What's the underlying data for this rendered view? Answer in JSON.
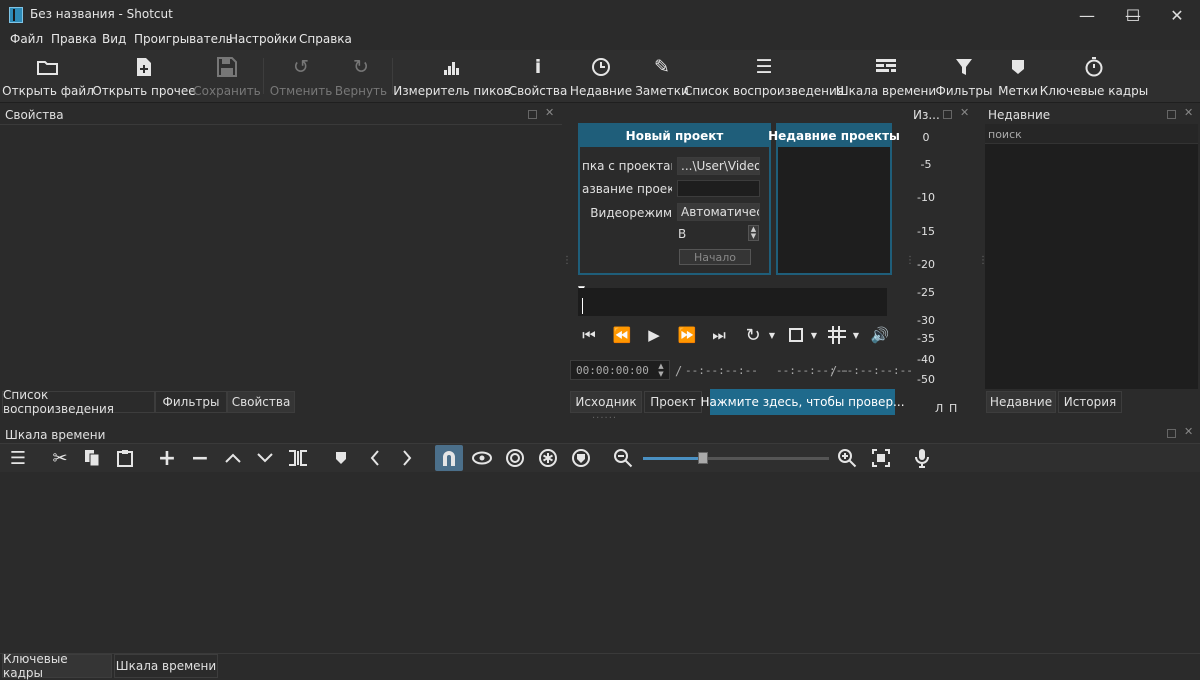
{
  "window": {
    "title": "Без названия - Shotcut",
    "minimize": "—",
    "maximize": "☐",
    "close": "✕"
  },
  "menu": [
    "Файл",
    "Правка",
    "Вид",
    "Проигрыватель",
    "Настройки",
    "Справка"
  ],
  "toolbar": {
    "open_file": "Открыть файл",
    "open_other": "Открыть прочее",
    "save": "Сохранить",
    "undo": "Отменить",
    "redo": "Вернуть",
    "peak_meter": "Измеритель пиков",
    "properties": "Свойства",
    "recent": "Недавние",
    "notes": "Заметки",
    "playlist": "Список воспроизведения",
    "timeline": "Шкала времени",
    "filters": "Фильтры",
    "markers": "Метки",
    "keyframes": "Ключевые кадры"
  },
  "properties_panel": {
    "title": "Свойства",
    "tabs": [
      "Список воспроизведения",
      "Фильтры",
      "Свойства"
    ]
  },
  "start_page": {
    "new_project_title": "Новый проект",
    "recent_projects_title": "Недавние проекты",
    "projects_folder_label": "пка с проектами",
    "projects_folder_value": "...\\User\\Videos",
    "project_name_label": "азвание проекта",
    "project_name_value": "",
    "video_mode_label": "Видеорежим",
    "video_mode_value": "Автоматически",
    "spin_value": "В",
    "start_button": "Начало"
  },
  "player": {
    "timecode": "00:00:00:00",
    "separator": "/",
    "duration": "--:--:--:--",
    "in_point": "--:--:--:--",
    "out_separator": "/",
    "out_point": "--:--:--:--",
    "tabs": [
      "Исходник",
      "Проект"
    ],
    "update_notice": "Нажмите здесь, чтобы провер..."
  },
  "meter": {
    "title": "Из...",
    "levels": [
      "0",
      "-5",
      "-10",
      "-15",
      "-20",
      "-25",
      "-30",
      "-35",
      "-40",
      "-50"
    ],
    "channels": [
      "Л",
      "П"
    ]
  },
  "recent_panel": {
    "title": "Недавние",
    "search_placeholder": "поиск",
    "tabs": [
      "Недавние",
      "История"
    ]
  },
  "timeline_panel": {
    "title": "Шкала времени",
    "zoom_level": 0.5
  },
  "bottom_tabs": [
    "Ключевые кадры",
    "Шкала времени"
  ],
  "colors": {
    "accent": "#1f5e7a",
    "notice_bg": "#1f6a8c",
    "snap_active": "#4b6f8a"
  }
}
